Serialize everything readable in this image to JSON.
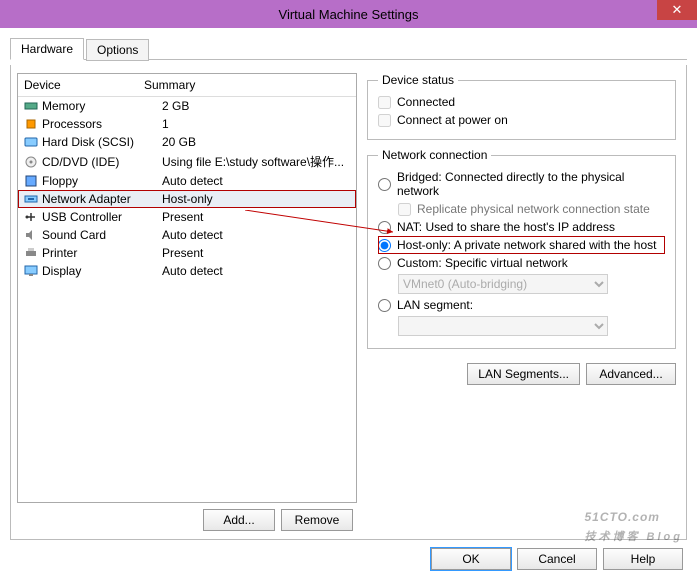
{
  "title": "Virtual Machine Settings",
  "tabs": {
    "hardware": "Hardware",
    "options": "Options"
  },
  "headers": {
    "device": "Device",
    "summary": "Summary"
  },
  "devices": [
    {
      "name": "Memory",
      "summary": "2 GB",
      "icon": "memory",
      "sel": false
    },
    {
      "name": "Processors",
      "summary": "1",
      "icon": "cpu",
      "sel": false
    },
    {
      "name": "Hard Disk (SCSI)",
      "summary": "20 GB",
      "icon": "hdd",
      "sel": false
    },
    {
      "name": "CD/DVD (IDE)",
      "summary": "Using file E:\\study software\\操作...",
      "icon": "cd",
      "sel": false
    },
    {
      "name": "Floppy",
      "summary": "Auto detect",
      "icon": "floppy",
      "sel": false
    },
    {
      "name": "Network Adapter",
      "summary": "Host-only",
      "icon": "net",
      "sel": true
    },
    {
      "name": "USB Controller",
      "summary": "Present",
      "icon": "usb",
      "sel": false
    },
    {
      "name": "Sound Card",
      "summary": "Auto detect",
      "icon": "sound",
      "sel": false
    },
    {
      "name": "Printer",
      "summary": "Present",
      "icon": "printer",
      "sel": false
    },
    {
      "name": "Display",
      "summary": "Auto detect",
      "icon": "display",
      "sel": false
    }
  ],
  "buttons": {
    "add": "Add...",
    "remove": "Remove",
    "lanSegments": "LAN Segments...",
    "advanced": "Advanced...",
    "ok": "OK",
    "cancel": "Cancel",
    "help": "Help"
  },
  "deviceStatus": {
    "legend": "Device status",
    "connected": "Connected",
    "poweron": "Connect at power on"
  },
  "netconn": {
    "legend": "Network connection",
    "bridged": "Bridged: Connected directly to the physical network",
    "replicate": "Replicate physical network connection state",
    "nat": "NAT: Used to share the host's IP address",
    "hostonly": "Host-only: A private network shared with the host",
    "custom": "Custom: Specific virtual network",
    "vmnet": "VMnet0 (Auto-bridging)",
    "lanseg": "LAN segment:"
  },
  "watermark": {
    "big": "51CTO.com",
    "small": "技术博客    Blog"
  }
}
